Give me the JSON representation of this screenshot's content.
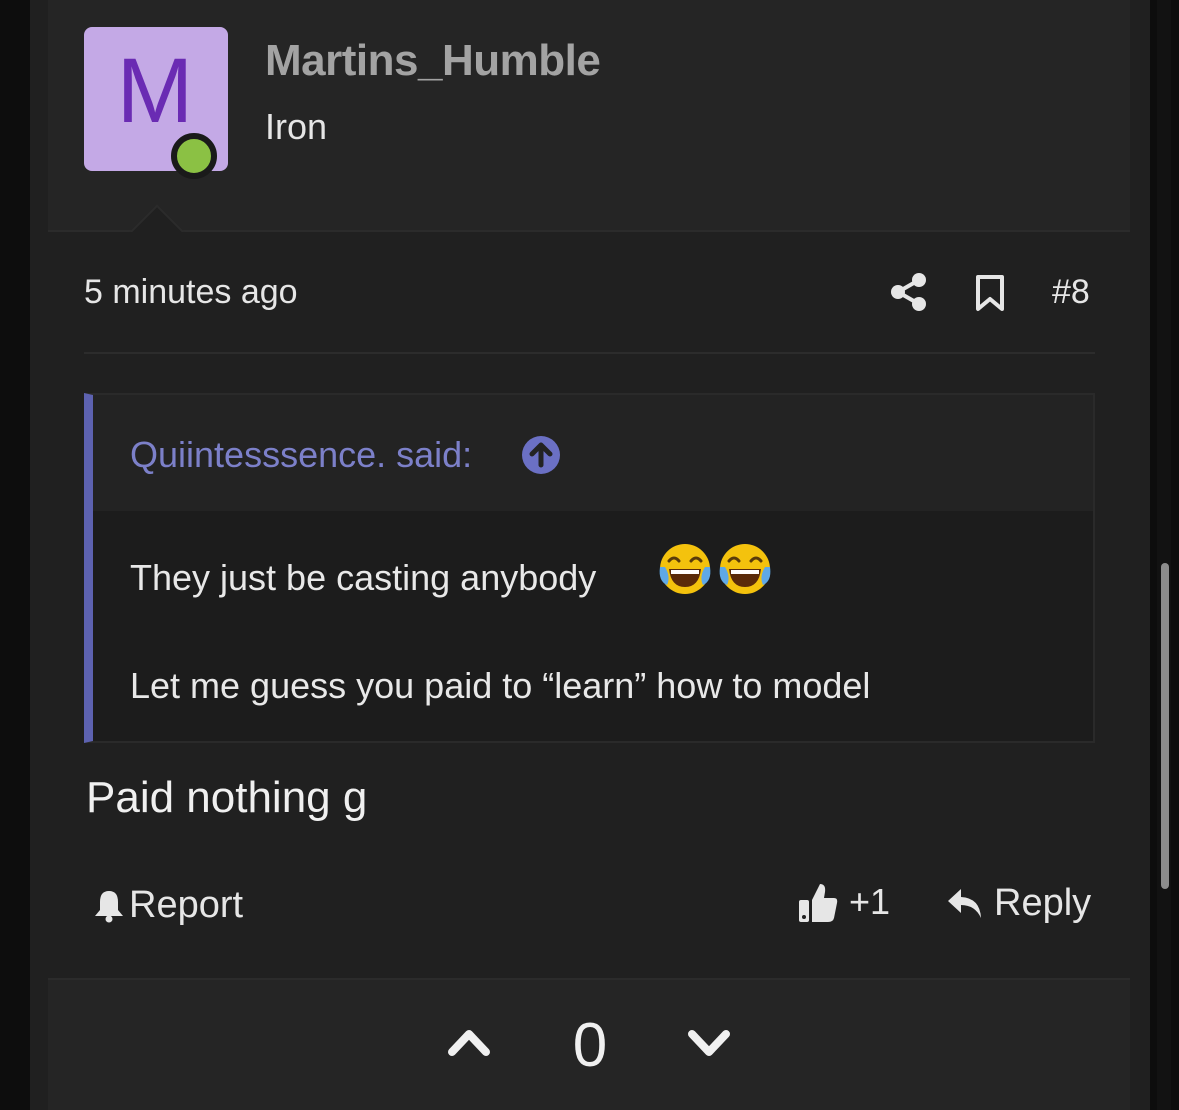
{
  "author": {
    "avatar_letter": "M",
    "avatar_color": "#c4a9e6",
    "online_status_color": "#8bc144",
    "username": "Martins_Humble",
    "title": "Iron"
  },
  "post_meta": {
    "timestamp": "5 minutes ago",
    "share_icon": "share-icon",
    "bookmark_icon": "bookmark-icon",
    "post_number": "#8"
  },
  "quote": {
    "author_label": "Quiintesssence. said:",
    "jump_icon": "arrow-up-circle-icon",
    "line1": "They just be casting anybody",
    "line1_emoji": [
      "face-with-tears-of-joy",
      "face-with-tears-of-joy"
    ],
    "line2": "Let me guess you paid to “learn” how to model",
    "accent_color": "#5d62b0"
  },
  "body": {
    "text": "Paid nothing g"
  },
  "actions": {
    "report_label": "Report",
    "like_label": "+1",
    "reply_label": "Reply"
  },
  "votes": {
    "count": "0"
  }
}
